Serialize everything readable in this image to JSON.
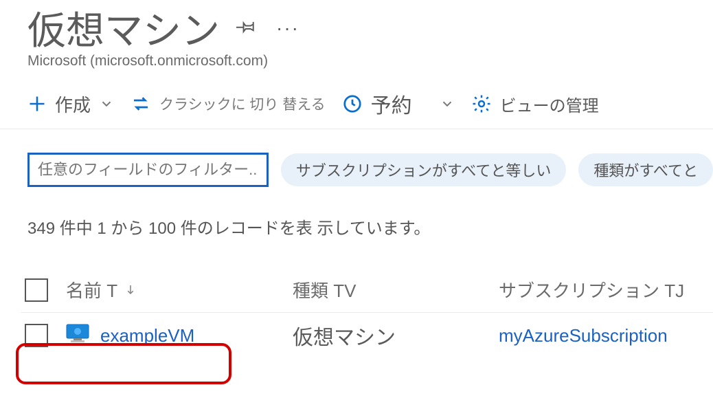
{
  "header": {
    "title": "仮想マシン",
    "tenant": "Microsoft (microsoft.onmicrosoft.com)"
  },
  "toolbar": {
    "create": "作成",
    "switch_classic": "クラシックに 切り 替える",
    "reservation": "予約",
    "view_manage": "ビューの管理"
  },
  "filters": {
    "placeholder": "任意のフィールドのフィルター..",
    "subscription_all": "サブスクリプションがすべてと等しい",
    "type_all": "種類がすべてと"
  },
  "record_count": "349 件中 1 から 100 件のレコードを表 示しています。",
  "columns": {
    "name": "名前 T",
    "type": "種類 TV",
    "subscription": "サブスクリプション TJ"
  },
  "rows": [
    {
      "name": "exampleVM",
      "type": "仮想マシン",
      "subscription": "myAzureSubscription"
    }
  ]
}
